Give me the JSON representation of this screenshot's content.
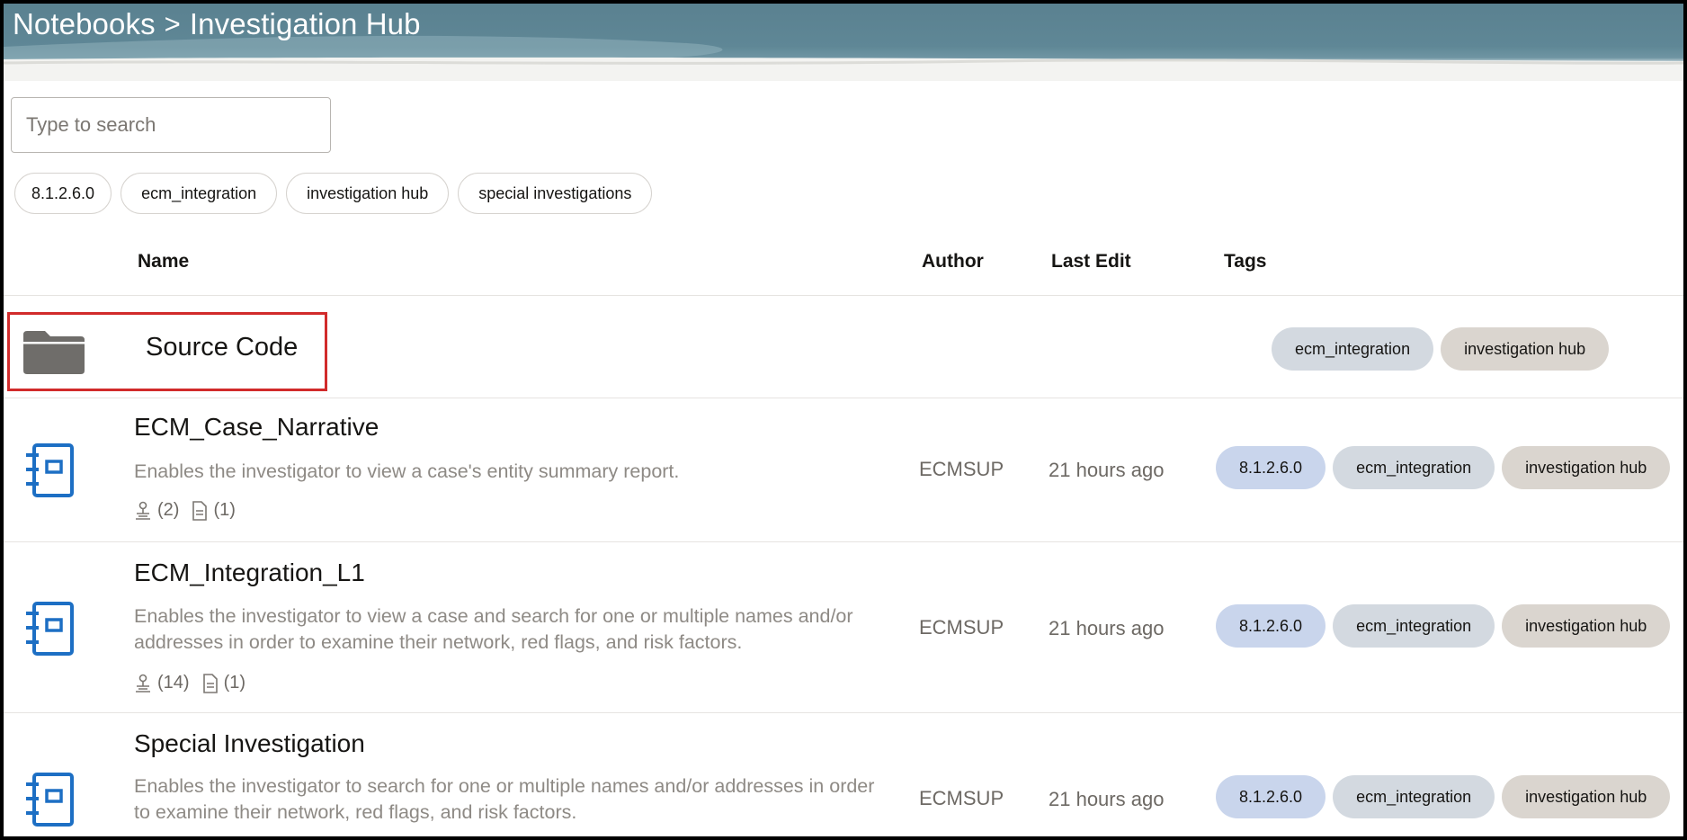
{
  "header": {
    "breadcrumb_root": "Notebooks",
    "breadcrumb_separator": ">",
    "breadcrumb_current": "Investigation Hub"
  },
  "search": {
    "placeholder": "Type to search"
  },
  "filter_tags": [
    "8.1.2.6.0",
    "ecm_integration",
    "investigation hub",
    "special investigations"
  ],
  "table": {
    "columns": {
      "name": "Name",
      "author": "Author",
      "last_edit": "Last Edit",
      "tags": "Tags"
    }
  },
  "folder": {
    "name": "Source Code",
    "icon": "folder-icon",
    "tags": [
      "ecm_integration",
      "investigation hub"
    ]
  },
  "notebooks": [
    {
      "title": "ECM_Case_Narrative",
      "description": "Enables the investigator to view a case's entity summary report.",
      "users_count": "(2)",
      "docs_count": "(1)",
      "author": "ECMSUP",
      "last_edit": "21 hours ago",
      "tags": [
        "8.1.2.6.0",
        "ecm_integration",
        "investigation hub"
      ]
    },
    {
      "title": "ECM_Integration_L1",
      "description": "Enables the investigator to view a case and search for one or multiple names and/or addresses in order to examine their network, red flags, and risk factors.",
      "users_count": "(14)",
      "docs_count": "(1)",
      "author": "ECMSUP",
      "last_edit": "21 hours ago",
      "tags": [
        "8.1.2.6.0",
        "ecm_integration",
        "investigation hub"
      ]
    },
    {
      "title": "Special Investigation",
      "description": "Enables the investigator to search for one or multiple names and/or addresses in order to examine their network, red flags, and risk factors.",
      "author": "ECMSUP",
      "last_edit": "21 hours ago",
      "tags": [
        "8.1.2.6.0",
        "ecm_integration",
        "investigation hub"
      ]
    }
  ],
  "colors": {
    "header_bg": "#5f8796",
    "highlight_border": "#d12b2b",
    "icon_blue": "#1d6fc4",
    "folder_grey": "#6f6d6a",
    "tag_blue": "#c9d5ec",
    "tag_grey": "#d3d9e0",
    "tag_stone": "#dad5cf"
  }
}
